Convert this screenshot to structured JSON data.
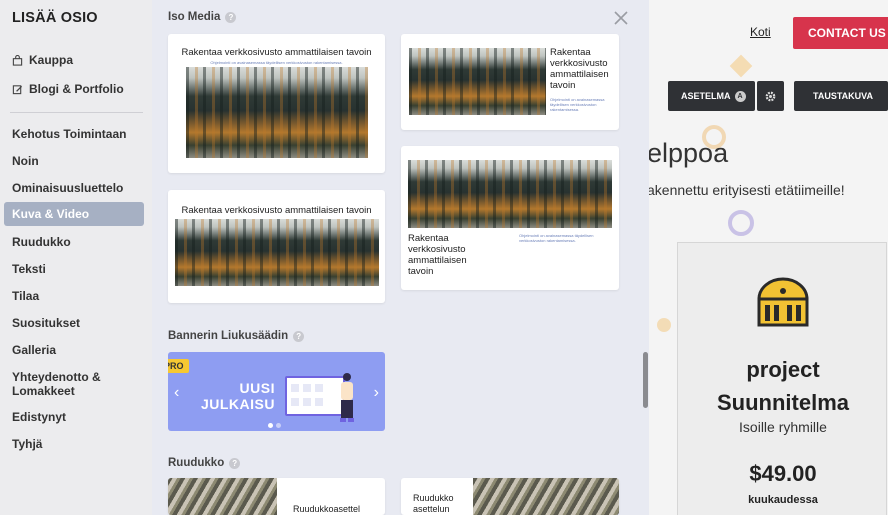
{
  "sidebar": {
    "title": "LISÄÄ OSIO",
    "top_items": [
      {
        "label": "Kauppa",
        "icon": "shopping-bag-icon"
      },
      {
        "label": "Blogi & Portfolio",
        "icon": "edit-icon"
      }
    ],
    "categories": [
      {
        "label": "Kehotus Toimintaan",
        "active": false
      },
      {
        "label": "Noin",
        "active": false
      },
      {
        "label": "Ominaisuusluettelo",
        "active": false
      },
      {
        "label": "Kuva & Video",
        "active": true
      },
      {
        "label": "Ruudukko",
        "active": false
      },
      {
        "label": "Teksti",
        "active": false
      },
      {
        "label": "Tilaa",
        "active": false
      },
      {
        "label": "Suositukset",
        "active": false
      },
      {
        "label": "Galleria",
        "active": false
      },
      {
        "label": "Yhteydenotto & Lomakkeet",
        "active": false
      },
      {
        "label": "Edistynyt",
        "active": false
      },
      {
        "label": "Tyhjä",
        "active": false
      }
    ]
  },
  "panel": {
    "sections": {
      "iso_media": {
        "label": "Iso Media"
      },
      "banner": {
        "label": "Bannerin Liukusäädin"
      },
      "ruudukko": {
        "label": "Ruudukko"
      }
    },
    "cards": {
      "heading": "Rakentaa verkkosivusto ammattilaisen tavoin",
      "heading_wrapped": "Rakentaa verkkosivusto ammattilaisen tavoin",
      "subtext": "Ohjelmointi on avainasemassa täydellisen verkkosivuston rakentamisessa.",
      "grid_1": "Ruudukkoasettel",
      "grid_2": "Ruudukko asettelun"
    },
    "banner": {
      "badge": "PRO",
      "text": "UUSI JULKAISU",
      "bg_color": "#8e9df2"
    },
    "close_icon": "close-icon"
  },
  "site": {
    "nav_home": "Koti",
    "contact": "CONTACT US",
    "btn_asetelma": "ASETELMA",
    "btn_asetelma_badge": "A",
    "btn_taustakuva": "TAUSTAKUVA",
    "headline": "elppoa",
    "subline": "akennettu erityisesti etätiimeille!",
    "card": {
      "title": "project Suunnitelma",
      "sub": "Isoille ryhmille",
      "price": "$49.00",
      "per": "kuukaudessa",
      "icon": "building-icon"
    },
    "accent_color": "#d7344c"
  }
}
